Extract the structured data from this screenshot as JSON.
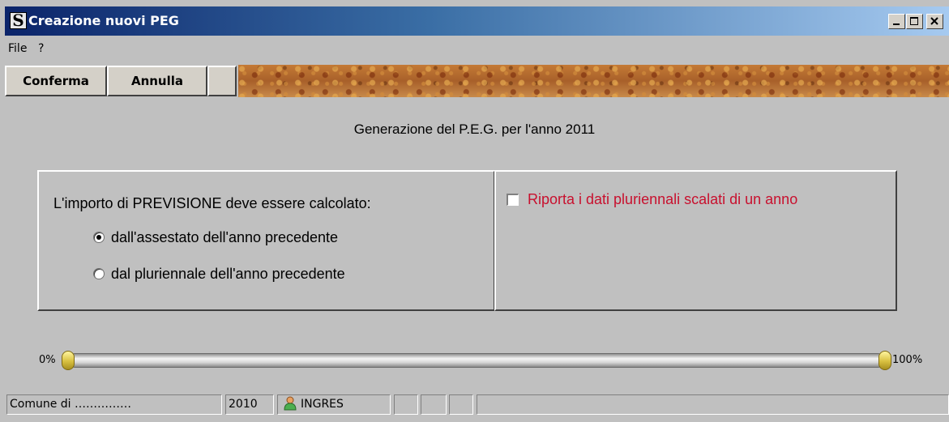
{
  "window": {
    "title": "Creazione nuovi PEG",
    "icon": "s-logo-icon",
    "controls": [
      "minimize-icon",
      "maximize-icon",
      "close-icon"
    ]
  },
  "menu": {
    "items": [
      "File",
      "?"
    ]
  },
  "toolbar": {
    "confirm_label": "Conferma",
    "cancel_label": "Annulla"
  },
  "heading": "Generazione del P.E.G. per l'anno 2011",
  "calc_panel": {
    "label": "L'importo di PREVISIONE deve essere calcolato:",
    "options": [
      {
        "label": "dall'assestato dell'anno precedente",
        "selected": true
      },
      {
        "label": "dal pluriennale dell'anno precedente",
        "selected": false
      }
    ]
  },
  "option_panel": {
    "checkbox_label": "Riporta i dati pluriennali scalati di un anno",
    "checked": false,
    "label_color": "#c8102e"
  },
  "progress": {
    "min_label": "0%",
    "max_label": "100%",
    "value": 0
  },
  "statusbar": {
    "comune": "Comune di ……………",
    "year": "2010",
    "user_icon": "user-icon",
    "user": "INGRES"
  }
}
